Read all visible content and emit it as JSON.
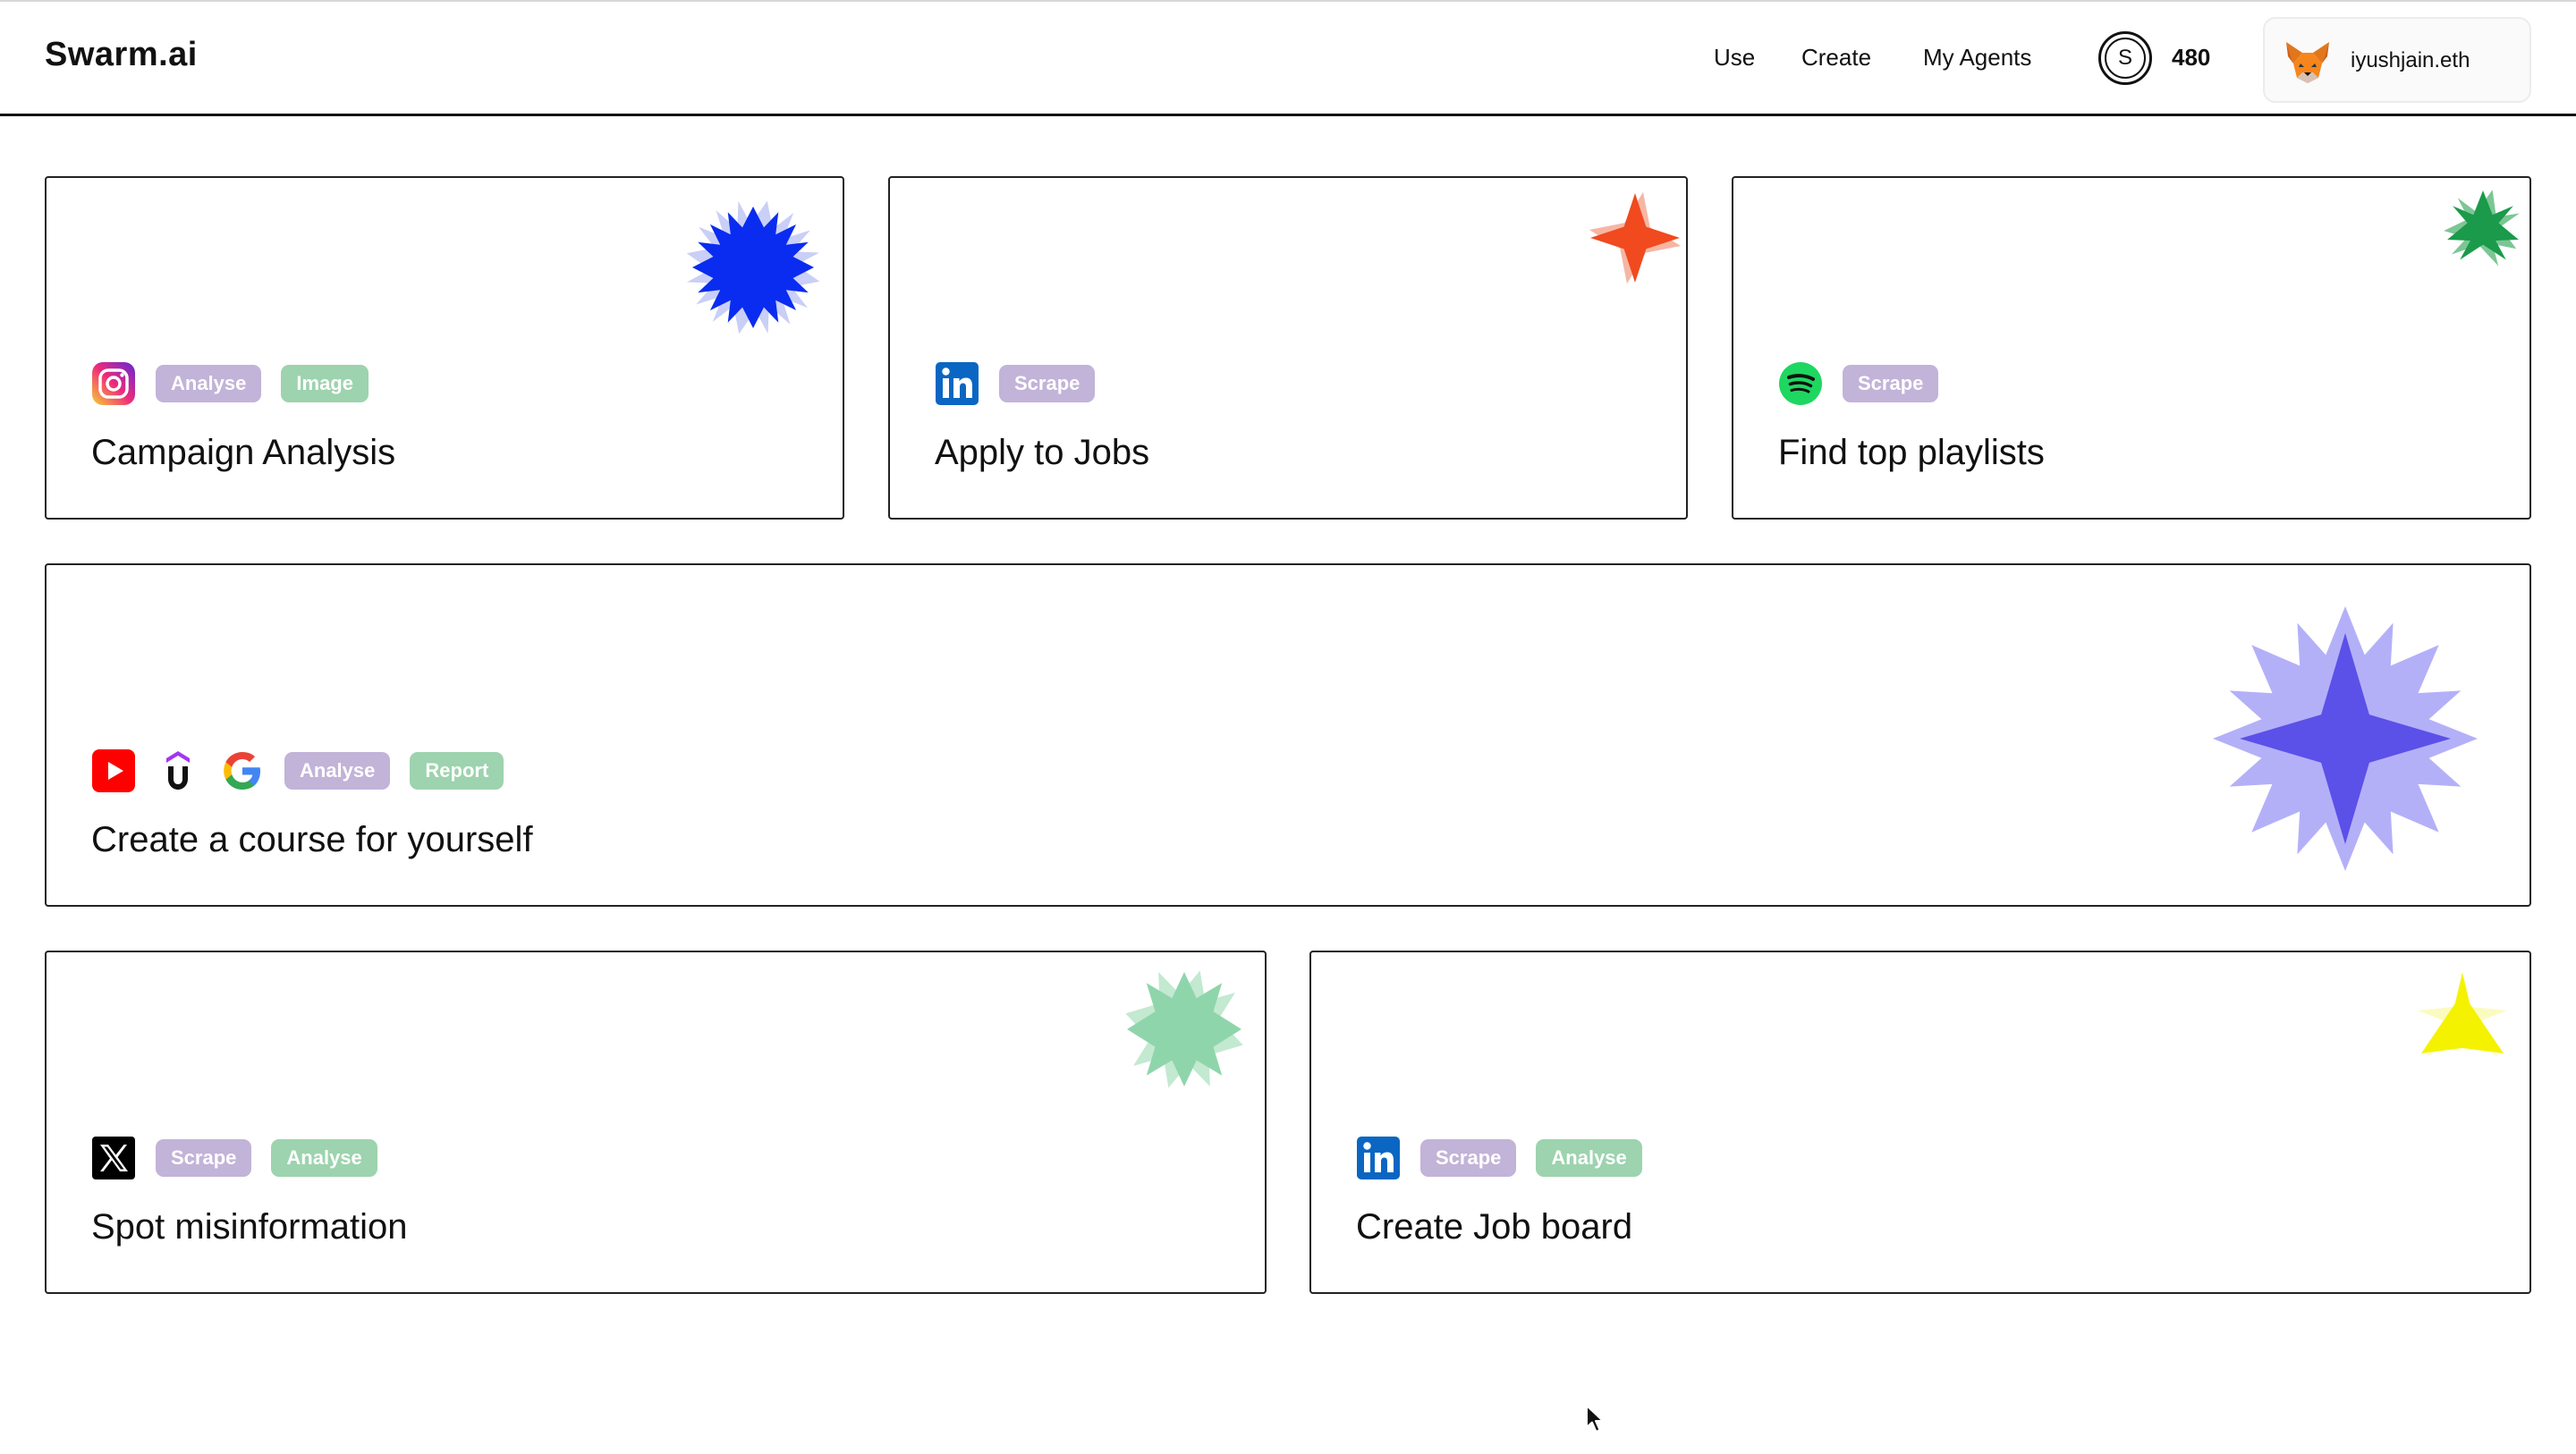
{
  "header": {
    "logo": "Swarm.ai",
    "nav": [
      "Use",
      "Create",
      "My Agents"
    ],
    "credits_symbol": "S",
    "credits": "480",
    "wallet_name": "iyushjain.eth",
    "wallet_icon": "metamask-fox-icon"
  },
  "cards": [
    {
      "title": "Campaign Analysis",
      "icons": [
        "instagram-icon"
      ],
      "tags": [
        "Analyse",
        "Image"
      ],
      "accent": "#0a2cf0"
    },
    {
      "title": "Apply to Jobs",
      "icons": [
        "linkedin-icon"
      ],
      "tags": [
        "Scrape"
      ],
      "accent": "#f04a1e"
    },
    {
      "title": "Find top playlists",
      "icons": [
        "spotify-icon"
      ],
      "tags": [
        "Scrape"
      ],
      "accent": "#1a9a4a"
    },
    {
      "title": "Create a course for yourself",
      "icons": [
        "youtube-icon",
        "udemy-icon",
        "google-icon"
      ],
      "tags": [
        "Analyse",
        "Report"
      ],
      "accent": "#5b50e8"
    },
    {
      "title": "Spot misinformation",
      "icons": [
        "x-icon"
      ],
      "tags": [
        "Scrape",
        "Analyse"
      ],
      "accent": "#8fd5ab"
    },
    {
      "title": "Create Job board",
      "icons": [
        "linkedin-icon"
      ],
      "tags": [
        "Scrape",
        "Analyse"
      ],
      "accent": "#f5f200"
    }
  ],
  "tag_colors": {
    "Analyse": "#c2b3d8",
    "Scrape": "#c2b3d8",
    "Image": "#9dd3ae",
    "Report": "#9dd3ae"
  }
}
